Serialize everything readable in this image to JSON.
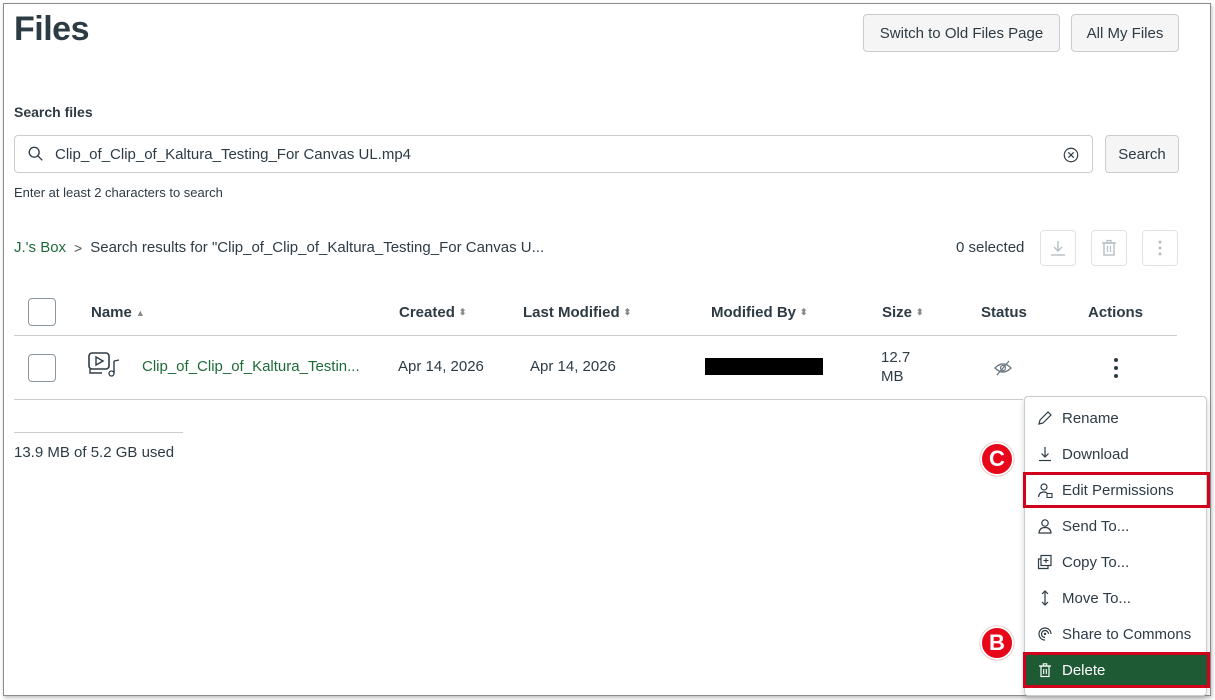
{
  "page": {
    "title": "Files",
    "switch_button": "Switch to Old Files Page",
    "all_files_button": "All My Files"
  },
  "search": {
    "label": "Search files",
    "value": "Clip_of_Clip_of_Kaltura_Testing_For Canvas UL.mp4",
    "button": "Search",
    "hint": "Enter at least 2 characters to search"
  },
  "breadcrumb": {
    "root": "J.'s Box",
    "separator": ">",
    "current": "Search results for \"Clip_of_Clip_of_Kaltura_Testing_For Canvas U..."
  },
  "selection": {
    "count_label": "0 selected"
  },
  "table": {
    "headers": {
      "name": "Name",
      "created": "Created",
      "last_modified": "Last Modified",
      "modified_by": "Modified By",
      "size": "Size",
      "status": "Status",
      "actions": "Actions"
    },
    "sort_asc": "▲",
    "sort_both": "⬍",
    "rows": [
      {
        "name": "Clip_of_Clip_of_Kaltura_Testin...",
        "created": "Apr 14, 2026",
        "last_modified": "Apr 14, 2026",
        "size_value": "12.7",
        "size_unit": "MB",
        "icon": "video-file-icon",
        "status_icon": "eye-hidden-icon"
      }
    ]
  },
  "usage": "13.9 MB of 5.2 GB used",
  "action_menu": {
    "items": [
      {
        "label": "Rename",
        "icon": "pencil-icon"
      },
      {
        "label": "Download",
        "icon": "download-icon"
      },
      {
        "label": "Edit Permissions",
        "icon": "user-lock-icon"
      },
      {
        "label": "Send To...",
        "icon": "user-icon"
      },
      {
        "label": "Copy To...",
        "icon": "copy-icon"
      },
      {
        "label": "Move To...",
        "icon": "move-icon"
      },
      {
        "label": "Share to Commons",
        "icon": "commons-icon"
      },
      {
        "label": "Delete",
        "icon": "trash-icon"
      }
    ]
  },
  "annotations": {
    "badge_c": "C",
    "badge_b": "B"
  },
  "colors": {
    "accent_green": "#1e6b3a",
    "delete_bg": "#1e5b34",
    "highlight_red": "#d0021b",
    "badge_red": "#e8071a"
  }
}
